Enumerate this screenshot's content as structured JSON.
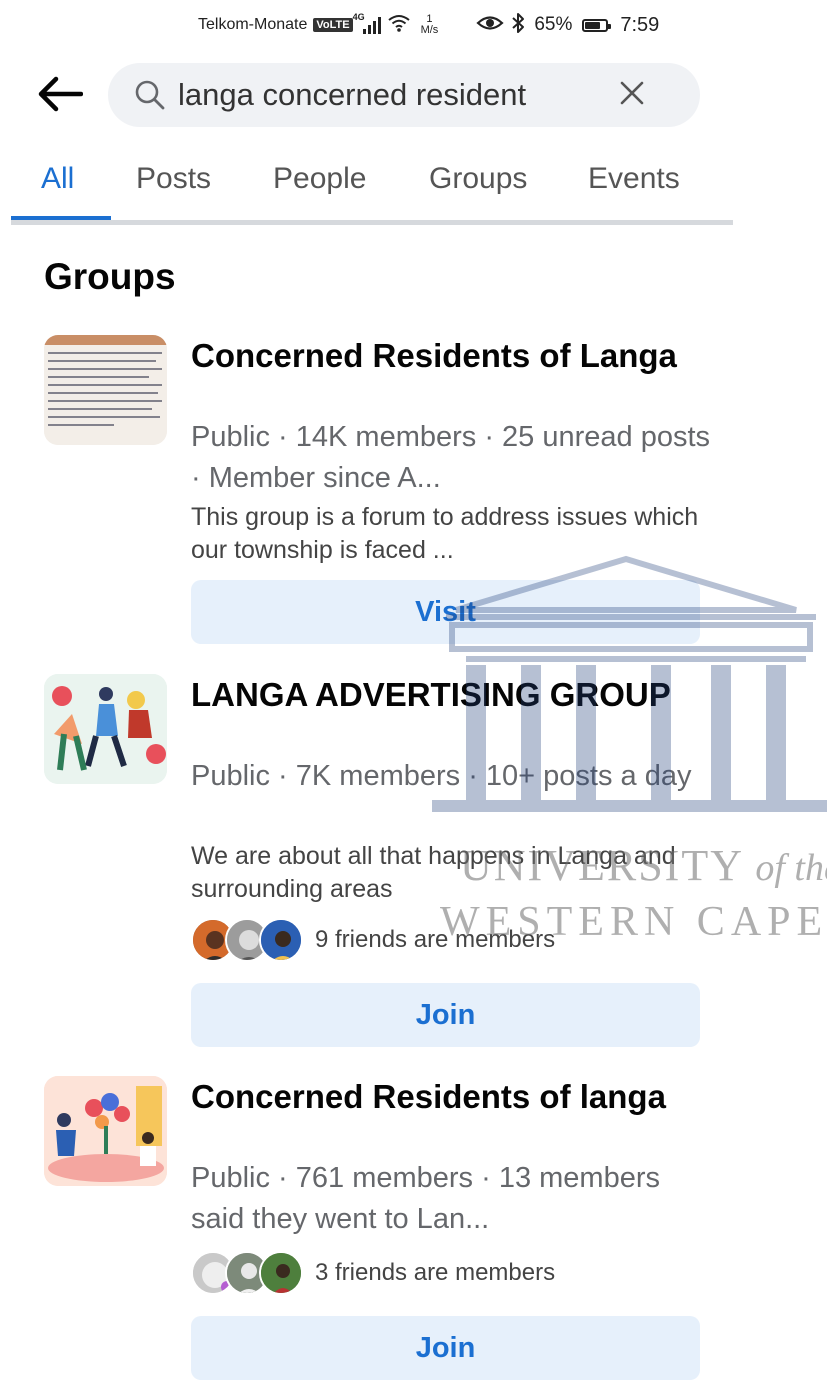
{
  "status_bar": {
    "carrier": "Telkom-Monate",
    "volte": "VoLTE",
    "network": "4G",
    "speed_value": "1",
    "speed_unit": "M/s",
    "battery_percent": "65%",
    "time": "7:59",
    "icons": [
      "signal-icon",
      "wifi-icon",
      "eye-icon",
      "bluetooth-icon",
      "battery-icon"
    ]
  },
  "search": {
    "query": "langa concerned resident",
    "icons": {
      "back": "back-arrow-icon",
      "search": "search-icon",
      "clear": "close-icon"
    }
  },
  "tabs": [
    {
      "label": "All",
      "active": true
    },
    {
      "label": "Posts",
      "active": false
    },
    {
      "label": "People",
      "active": false
    },
    {
      "label": "Groups",
      "active": false
    },
    {
      "label": "Events",
      "active": false
    }
  ],
  "section_title": "Groups",
  "groups": [
    {
      "name": "Concerned Residents of Langa",
      "meta": "Public · 14K members · 25 unread posts · Member since A...",
      "description": "This group is a forum to address issues which our township is faced ...",
      "button": "Visit"
    },
    {
      "name": "LANGA ADVERTISING GROUP",
      "meta": "Public · 7K members · 10+ posts a day",
      "description": "We are about all that happens in Langa and surrounding areas",
      "friends_text": "9 friends are members",
      "button": "Join"
    },
    {
      "name": "Concerned Residents of langa",
      "meta": "Public · 761 members · 13 members said they went to Lan...",
      "friends_text": "3 friends are members",
      "button": "Join"
    }
  ],
  "watermark": {
    "line1": "UNIVERSITY",
    "line1_suffix": "of the",
    "line2": "WESTERN CAPE"
  },
  "colors": {
    "accent": "#1b6fd1",
    "button_bg": "#e6f0fb",
    "search_bg": "#f0f2f5",
    "muted_text": "#65676b"
  }
}
